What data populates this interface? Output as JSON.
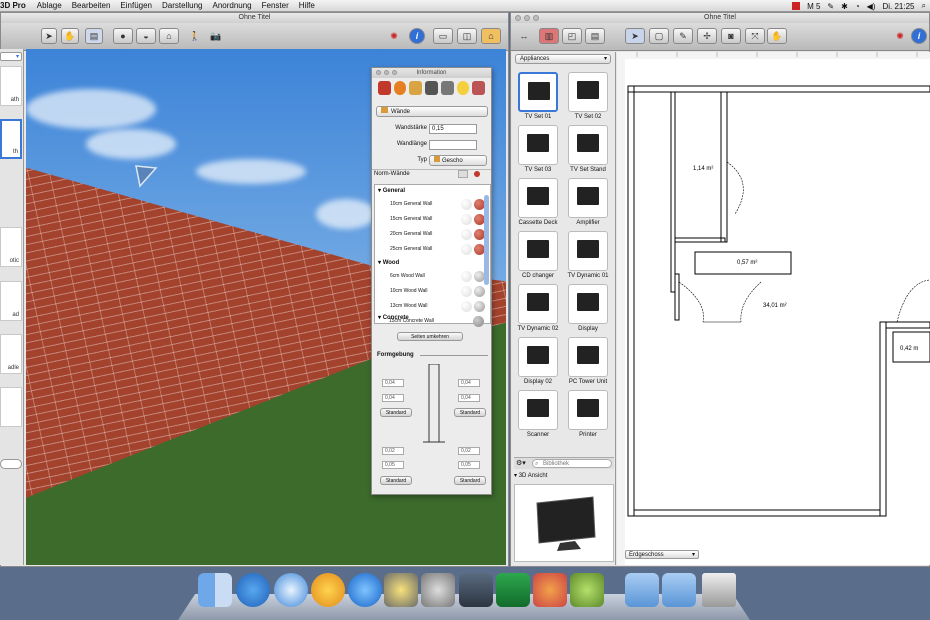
{
  "menubar": {
    "app": "3D Pro",
    "items": [
      "Ablage",
      "Bearbeiten",
      "Einfügen",
      "Darstellung",
      "Anordnung",
      "Fenster",
      "Hilfe"
    ],
    "status_text": "M 5",
    "clock": "Di. 21:25"
  },
  "left_window": {
    "title": "Ohne Titel",
    "palette_labels": [
      "ath",
      "th",
      "otic",
      "ad",
      "adle"
    ]
  },
  "info_panel": {
    "title": "Information",
    "category": "Wände",
    "thickness_label": "Wandstärke",
    "thickness_value": "0,15",
    "length_label": "Wandlänge",
    "type_label": "Typ",
    "type_value": "Gescho",
    "norm_walls": "Norm-Wände",
    "groups": [
      {
        "name": "General",
        "items": [
          "10cm General Wall",
          "15cm General Wall",
          "20cm General Wall",
          "25cm General Wall"
        ]
      },
      {
        "name": "Wood",
        "items": [
          "6cm Wood Wall",
          "10cm Wood Wall",
          "13cm Wood Wall"
        ]
      },
      {
        "name": "Concrete",
        "items": [
          "15cm Concrete Wall"
        ]
      }
    ],
    "flip_button": "Seiten umkehren",
    "shaping_label": "Formgebung",
    "v1": "0,04",
    "v2": "0,04",
    "v3": "0,04",
    "v4": "0,04",
    "v5": "0,02",
    "v6": "0,05",
    "v7": "0,02",
    "v8": "0,05",
    "standard": "Standard"
  },
  "right_window": {
    "title": "Ohne Titel",
    "catalog_dropdown": "Appliances",
    "catalog_items": [
      "TV Set 01",
      "TV Set 02",
      "TV Set 03",
      "TV Set Stand",
      "Cassette Deck",
      "Amplifier",
      "CD changer",
      "TV Dynamic 01",
      "TV Dynamic 02",
      "Display",
      "Display 02",
      "PC Tower Unit",
      "Scanner",
      "Printer"
    ],
    "search_placeholder": "Bibliothek",
    "preview_label": "3D Ansicht",
    "floor_dropdown": "Erdgeschoss",
    "room_areas": [
      "1,14 m²",
      "0,57 m²",
      "34,01 m²",
      "0,42 m"
    ]
  },
  "colors": {
    "brick": "#a4432d",
    "grass": "#3c6b2c",
    "sky": "#3c83d8",
    "selection": "#3a78d8"
  }
}
